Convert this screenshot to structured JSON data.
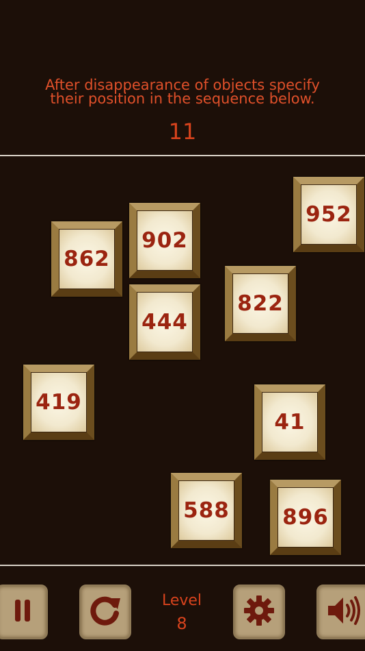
{
  "instructions": {
    "line1": "After disappearance of objects specify",
    "line2": "their position in the sequence below."
  },
  "counter": "11",
  "tiles": [
    {
      "label": "952"
    },
    {
      "label": "902"
    },
    {
      "label": "862"
    },
    {
      "label": "822"
    },
    {
      "label": "444"
    },
    {
      "label": "419"
    },
    {
      "label": "41"
    },
    {
      "label": "588"
    },
    {
      "label": "896"
    }
  ],
  "toolbar": {
    "level_label": "Level",
    "level_value": "8",
    "pause_icon": "pause-icon",
    "restart_icon": "restart-icon",
    "settings_icon": "gear-icon",
    "sound_icon": "speaker-icon"
  },
  "colors": {
    "background": "#1c0f08",
    "accent_text": "#d8431d",
    "tile_text": "#9b2410",
    "button_face": "#b6a07a",
    "icon": "#6e1a0d"
  }
}
